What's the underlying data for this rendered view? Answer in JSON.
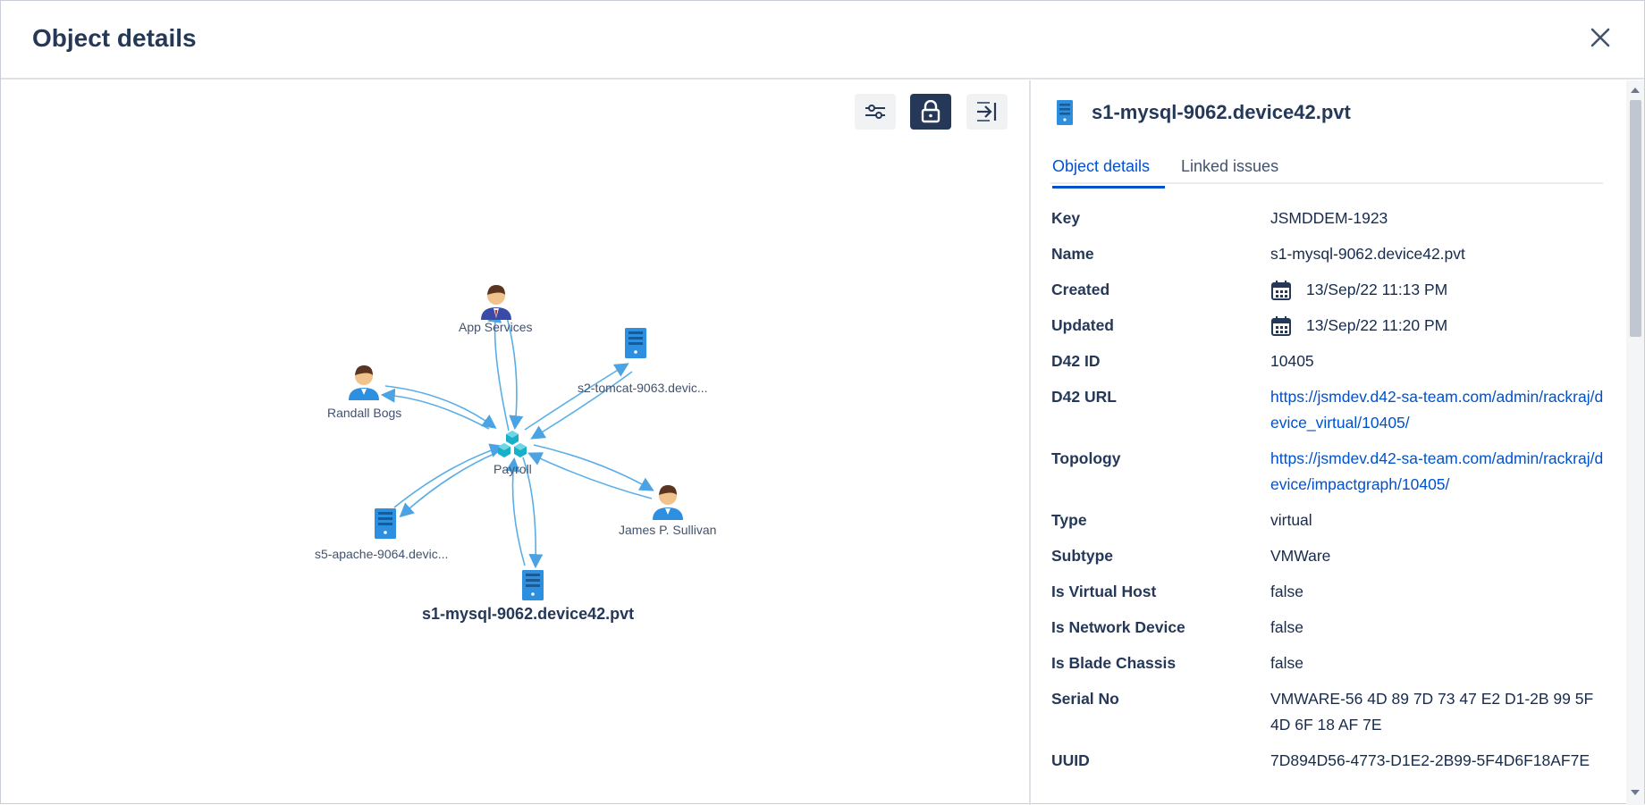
{
  "modal": {
    "title": "Object details"
  },
  "graph": {
    "nodes": [
      {
        "id": "app-services",
        "label": "App Services",
        "kind": "person"
      },
      {
        "id": "randall",
        "label": "Randall Bogs",
        "kind": "person"
      },
      {
        "id": "tomcat",
        "label": "s2-tomcat-9063.devic...",
        "kind": "server"
      },
      {
        "id": "payroll",
        "label": "Payroll",
        "kind": "service"
      },
      {
        "id": "james",
        "label": "James P. Sullivan",
        "kind": "person"
      },
      {
        "id": "apache",
        "label": "s5-apache-9064.devic...",
        "kind": "server"
      },
      {
        "id": "mysql",
        "label": "s1-mysql-9062.device42.pvt",
        "kind": "server"
      }
    ]
  },
  "panel": {
    "title": "s1-mysql-9062.device42.pvt",
    "tabs": [
      "Object details",
      "Linked issues"
    ],
    "fields": [
      {
        "label": "Key",
        "value": "JSMDDEM-1923"
      },
      {
        "label": "Name",
        "value": "s1-mysql-9062.device42.pvt"
      },
      {
        "label": "Created",
        "value": "13/Sep/22 11:13 PM"
      },
      {
        "label": "Updated",
        "value": "13/Sep/22 11:20 PM"
      },
      {
        "label": "D42 ID",
        "value": "10405"
      },
      {
        "label": "D42 URL",
        "value": "https://jsmdev.d42-sa-team.com/admin/rackraj/device_virtual/10405/"
      },
      {
        "label": "Topology",
        "value": "https://jsmdev.d42-sa-team.com/admin/rackraj/device/impactgraph/10405/"
      },
      {
        "label": "Type",
        "value": "virtual"
      },
      {
        "label": "Subtype",
        "value": "VMWare"
      },
      {
        "label": "Is Virtual Host",
        "value": "false"
      },
      {
        "label": "Is Network Device",
        "value": "false"
      },
      {
        "label": "Is Blade Chassis",
        "value": "false"
      },
      {
        "label": "Serial No",
        "value": "VMWARE-56 4D 89 7D 73 47 E2 D1-2B 99 5F 4D 6F 18 AF 7E"
      },
      {
        "label": "UUID",
        "value": "7D894D56-4773-D1E2-2B99-5F4D6F18AF7E"
      }
    ]
  },
  "colors": {
    "accent": "#0052cc",
    "edge": "#4ba3e3",
    "server": "#2d8fe0",
    "dark": "#253858"
  },
  "icons": [
    "close-icon",
    "filter-sliders-icon",
    "lock-icon",
    "collapse-panel-icon",
    "server-icon",
    "person-icon",
    "service-icon",
    "calendar-icon"
  ]
}
